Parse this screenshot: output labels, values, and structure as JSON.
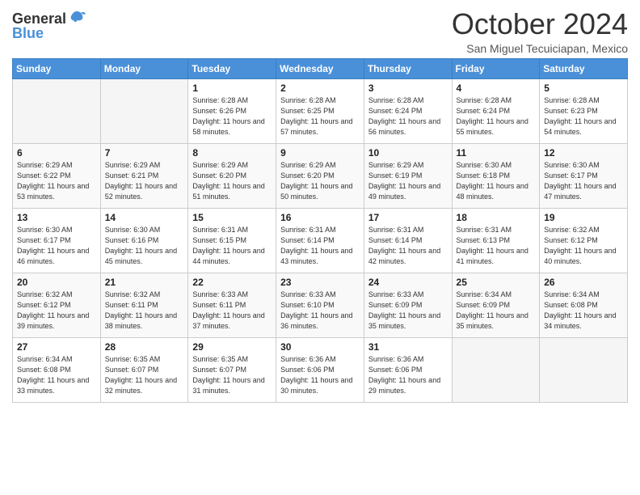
{
  "logo": {
    "line1": "General",
    "line2": "Blue"
  },
  "title": "October 2024",
  "location": "San Miguel Tecuiciapan, Mexico",
  "days_of_week": [
    "Sunday",
    "Monday",
    "Tuesday",
    "Wednesday",
    "Thursday",
    "Friday",
    "Saturday"
  ],
  "weeks": [
    [
      {
        "day": "",
        "sunrise": "",
        "sunset": "",
        "daylight": ""
      },
      {
        "day": "",
        "sunrise": "",
        "sunset": "",
        "daylight": ""
      },
      {
        "day": "1",
        "sunrise": "Sunrise: 6:28 AM",
        "sunset": "Sunset: 6:26 PM",
        "daylight": "Daylight: 11 hours and 58 minutes."
      },
      {
        "day": "2",
        "sunrise": "Sunrise: 6:28 AM",
        "sunset": "Sunset: 6:25 PM",
        "daylight": "Daylight: 11 hours and 57 minutes."
      },
      {
        "day": "3",
        "sunrise": "Sunrise: 6:28 AM",
        "sunset": "Sunset: 6:24 PM",
        "daylight": "Daylight: 11 hours and 56 minutes."
      },
      {
        "day": "4",
        "sunrise": "Sunrise: 6:28 AM",
        "sunset": "Sunset: 6:24 PM",
        "daylight": "Daylight: 11 hours and 55 minutes."
      },
      {
        "day": "5",
        "sunrise": "Sunrise: 6:28 AM",
        "sunset": "Sunset: 6:23 PM",
        "daylight": "Daylight: 11 hours and 54 minutes."
      }
    ],
    [
      {
        "day": "6",
        "sunrise": "Sunrise: 6:29 AM",
        "sunset": "Sunset: 6:22 PM",
        "daylight": "Daylight: 11 hours and 53 minutes."
      },
      {
        "day": "7",
        "sunrise": "Sunrise: 6:29 AM",
        "sunset": "Sunset: 6:21 PM",
        "daylight": "Daylight: 11 hours and 52 minutes."
      },
      {
        "day": "8",
        "sunrise": "Sunrise: 6:29 AM",
        "sunset": "Sunset: 6:20 PM",
        "daylight": "Daylight: 11 hours and 51 minutes."
      },
      {
        "day": "9",
        "sunrise": "Sunrise: 6:29 AM",
        "sunset": "Sunset: 6:20 PM",
        "daylight": "Daylight: 11 hours and 50 minutes."
      },
      {
        "day": "10",
        "sunrise": "Sunrise: 6:29 AM",
        "sunset": "Sunset: 6:19 PM",
        "daylight": "Daylight: 11 hours and 49 minutes."
      },
      {
        "day": "11",
        "sunrise": "Sunrise: 6:30 AM",
        "sunset": "Sunset: 6:18 PM",
        "daylight": "Daylight: 11 hours and 48 minutes."
      },
      {
        "day": "12",
        "sunrise": "Sunrise: 6:30 AM",
        "sunset": "Sunset: 6:17 PM",
        "daylight": "Daylight: 11 hours and 47 minutes."
      }
    ],
    [
      {
        "day": "13",
        "sunrise": "Sunrise: 6:30 AM",
        "sunset": "Sunset: 6:17 PM",
        "daylight": "Daylight: 11 hours and 46 minutes."
      },
      {
        "day": "14",
        "sunrise": "Sunrise: 6:30 AM",
        "sunset": "Sunset: 6:16 PM",
        "daylight": "Daylight: 11 hours and 45 minutes."
      },
      {
        "day": "15",
        "sunrise": "Sunrise: 6:31 AM",
        "sunset": "Sunset: 6:15 PM",
        "daylight": "Daylight: 11 hours and 44 minutes."
      },
      {
        "day": "16",
        "sunrise": "Sunrise: 6:31 AM",
        "sunset": "Sunset: 6:14 PM",
        "daylight": "Daylight: 11 hours and 43 minutes."
      },
      {
        "day": "17",
        "sunrise": "Sunrise: 6:31 AM",
        "sunset": "Sunset: 6:14 PM",
        "daylight": "Daylight: 11 hours and 42 minutes."
      },
      {
        "day": "18",
        "sunrise": "Sunrise: 6:31 AM",
        "sunset": "Sunset: 6:13 PM",
        "daylight": "Daylight: 11 hours and 41 minutes."
      },
      {
        "day": "19",
        "sunrise": "Sunrise: 6:32 AM",
        "sunset": "Sunset: 6:12 PM",
        "daylight": "Daylight: 11 hours and 40 minutes."
      }
    ],
    [
      {
        "day": "20",
        "sunrise": "Sunrise: 6:32 AM",
        "sunset": "Sunset: 6:12 PM",
        "daylight": "Daylight: 11 hours and 39 minutes."
      },
      {
        "day": "21",
        "sunrise": "Sunrise: 6:32 AM",
        "sunset": "Sunset: 6:11 PM",
        "daylight": "Daylight: 11 hours and 38 minutes."
      },
      {
        "day": "22",
        "sunrise": "Sunrise: 6:33 AM",
        "sunset": "Sunset: 6:11 PM",
        "daylight": "Daylight: 11 hours and 37 minutes."
      },
      {
        "day": "23",
        "sunrise": "Sunrise: 6:33 AM",
        "sunset": "Sunset: 6:10 PM",
        "daylight": "Daylight: 11 hours and 36 minutes."
      },
      {
        "day": "24",
        "sunrise": "Sunrise: 6:33 AM",
        "sunset": "Sunset: 6:09 PM",
        "daylight": "Daylight: 11 hours and 35 minutes."
      },
      {
        "day": "25",
        "sunrise": "Sunrise: 6:34 AM",
        "sunset": "Sunset: 6:09 PM",
        "daylight": "Daylight: 11 hours and 35 minutes."
      },
      {
        "day": "26",
        "sunrise": "Sunrise: 6:34 AM",
        "sunset": "Sunset: 6:08 PM",
        "daylight": "Daylight: 11 hours and 34 minutes."
      }
    ],
    [
      {
        "day": "27",
        "sunrise": "Sunrise: 6:34 AM",
        "sunset": "Sunset: 6:08 PM",
        "daylight": "Daylight: 11 hours and 33 minutes."
      },
      {
        "day": "28",
        "sunrise": "Sunrise: 6:35 AM",
        "sunset": "Sunset: 6:07 PM",
        "daylight": "Daylight: 11 hours and 32 minutes."
      },
      {
        "day": "29",
        "sunrise": "Sunrise: 6:35 AM",
        "sunset": "Sunset: 6:07 PM",
        "daylight": "Daylight: 11 hours and 31 minutes."
      },
      {
        "day": "30",
        "sunrise": "Sunrise: 6:36 AM",
        "sunset": "Sunset: 6:06 PM",
        "daylight": "Daylight: 11 hours and 30 minutes."
      },
      {
        "day": "31",
        "sunrise": "Sunrise: 6:36 AM",
        "sunset": "Sunset: 6:06 PM",
        "daylight": "Daylight: 11 hours and 29 minutes."
      },
      {
        "day": "",
        "sunrise": "",
        "sunset": "",
        "daylight": ""
      },
      {
        "day": "",
        "sunrise": "",
        "sunset": "",
        "daylight": ""
      }
    ]
  ]
}
